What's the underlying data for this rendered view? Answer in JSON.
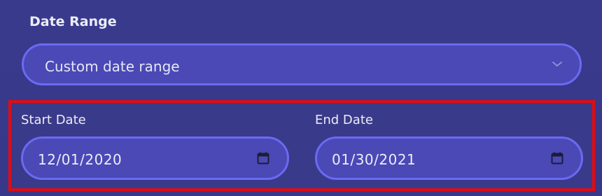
{
  "date_range": {
    "label": "Date Range",
    "selected": "Custom date range"
  },
  "start_date": {
    "label": "Start Date",
    "value": "12/01/2020"
  },
  "end_date": {
    "label": "End Date",
    "value": "01/30/2021"
  },
  "icons": {
    "select": "chevron-down-icon",
    "date": "calendar-icon"
  },
  "colors": {
    "background": "#3a3a8c",
    "field_fill": "#4a49b6",
    "field_border": "#6b6af2",
    "highlight": "#e00c12"
  }
}
